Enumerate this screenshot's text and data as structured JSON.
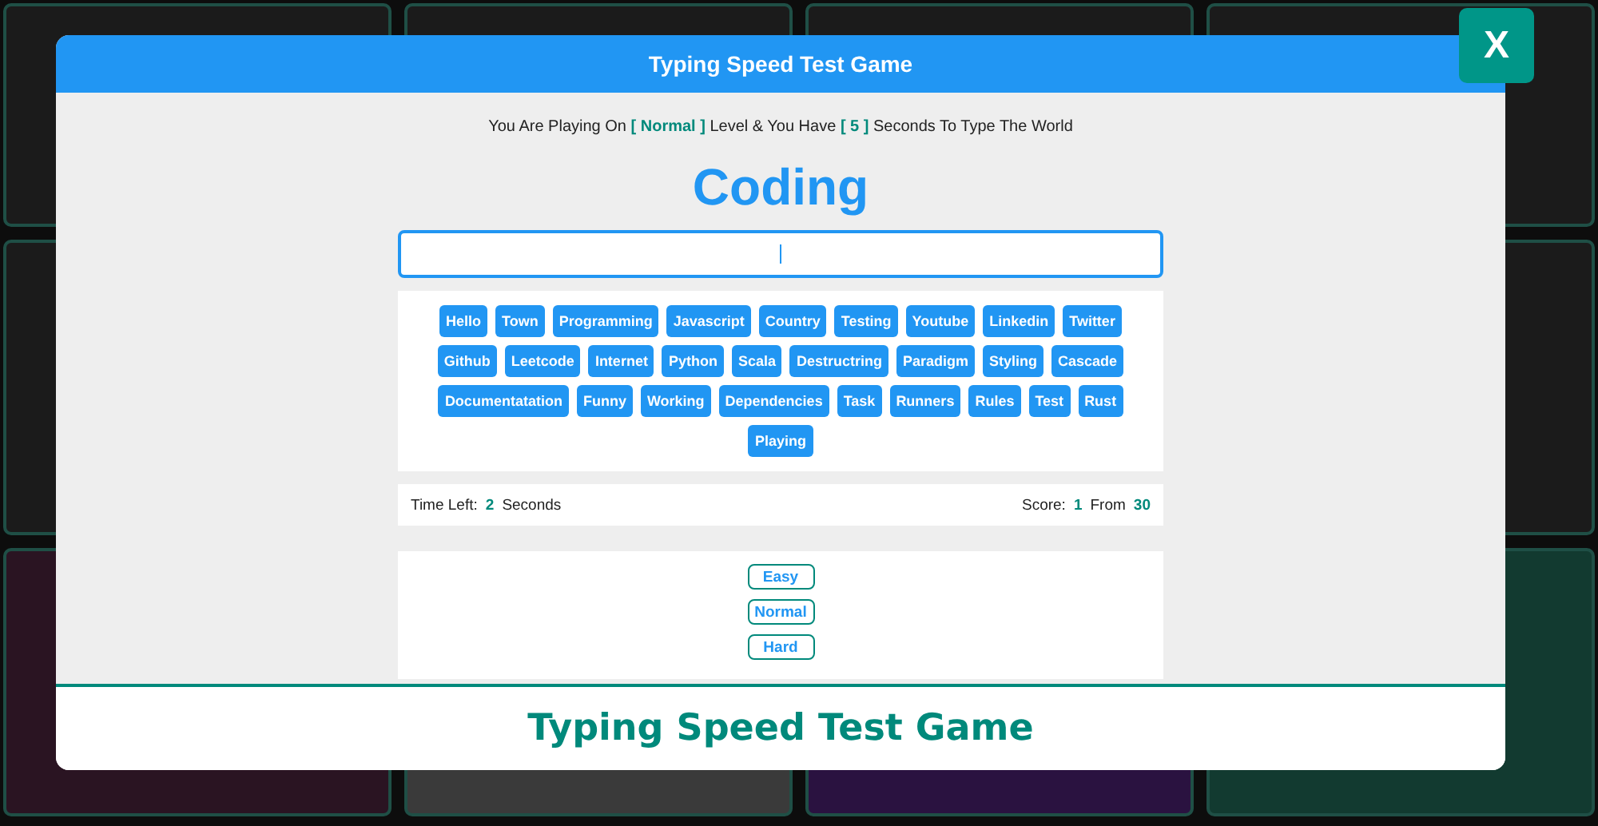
{
  "header": {
    "title": "Typing Speed Test Game"
  },
  "close_button": {
    "label": "X"
  },
  "message": "You Are Playing On **[ Normal ]** Level & You Have **[ 5 ]** Seconds To Type The World",
  "current_word": "Coding",
  "words": [
    "Hello",
    "Town",
    "Programming",
    "Javascript",
    "Country",
    "Testing",
    "Youtube",
    "Linkedin",
    "Twitter",
    "Github",
    "Leetcode",
    "Internet",
    "Python",
    "Scala",
    "Destructring",
    "Paradigm",
    "Styling",
    "Cascade",
    "Documentatation",
    "Funny",
    "Working",
    "Dependencies",
    "Task",
    "Runners",
    "Rules",
    "Test",
    "Rust",
    "Playing"
  ],
  "stats": {
    "time_label": "Time Left:",
    "time_value": "2",
    "time_unit": "Seconds",
    "score_label": "Score:",
    "score_value": "1",
    "score_from": "From",
    "score_total": "30"
  },
  "levels": [
    "Easy",
    "Normal",
    "Hard"
  ],
  "footer": {
    "title": "Typing Speed Test Game"
  }
}
